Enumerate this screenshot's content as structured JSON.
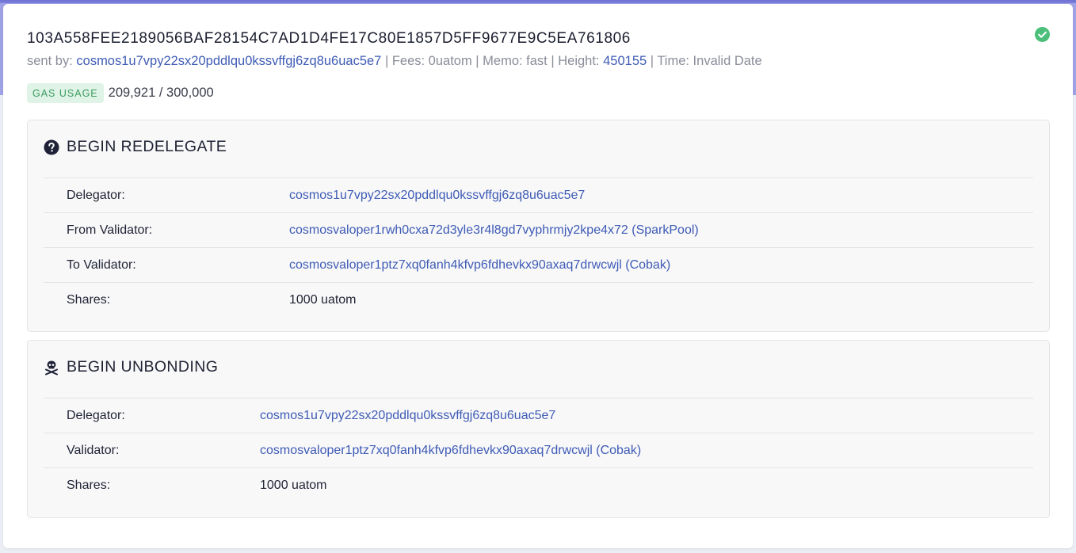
{
  "tx": {
    "hash": "103A558FEE2189056BAF28154C7AD1D4FE17C80E1857D5FF9677E9C5EA761806",
    "status_icon": "check-circle-icon",
    "status_color": "#4cc07a",
    "sent_by_label": "sent by:",
    "sent_by": "cosmos1u7vpy22sx20pddlqu0kssvffgj6zq8u6uac5e7",
    "fees_text": "| Fees: 0uatom | Memo: fast | Height:",
    "height": "450155",
    "time_text": "| Time: Invalid Date",
    "gas_label": "GAS USAGE",
    "gas_value": "209,921 / 300,000"
  },
  "colors": {
    "link": "#3e5bb5",
    "badge_bg": "#dff3e6",
    "badge_text": "#3a9c5f",
    "header_accent": "#7b7fd9"
  },
  "messages": [
    {
      "title": "BEGIN REDELEGATE",
      "icon": "question-circle-icon",
      "rows": [
        {
          "label": "Delegator:",
          "value": "cosmos1u7vpy22sx20pddlqu0kssvffgj6zq8u6uac5e7",
          "link": true
        },
        {
          "label": "From Validator:",
          "value": "cosmosvaloper1rwh0cxa72d3yle3r4l8gd7vyphrmjy2kpe4x72 (SparkPool)",
          "link": true
        },
        {
          "label": "To Validator:",
          "value": "cosmosvaloper1ptz7xq0fanh4kfvp6fdhevkx90axaq7drwcwjl (Cobak)",
          "link": true
        },
        {
          "label": "Shares:",
          "value": "1000 uatom",
          "link": false
        }
      ]
    },
    {
      "title": "BEGIN UNBONDING",
      "icon": "skull-crossbones-icon",
      "rows": [
        {
          "label": "Delegator:",
          "value": "cosmos1u7vpy22sx20pddlqu0kssvffgj6zq8u6uac5e7",
          "link": true
        },
        {
          "label": "Validator:",
          "value": "cosmosvaloper1ptz7xq0fanh4kfvp6fdhevkx90axaq7drwcwjl (Cobak)",
          "link": true
        },
        {
          "label": "Shares:",
          "value": "1000 uatom",
          "link": false
        }
      ]
    }
  ]
}
